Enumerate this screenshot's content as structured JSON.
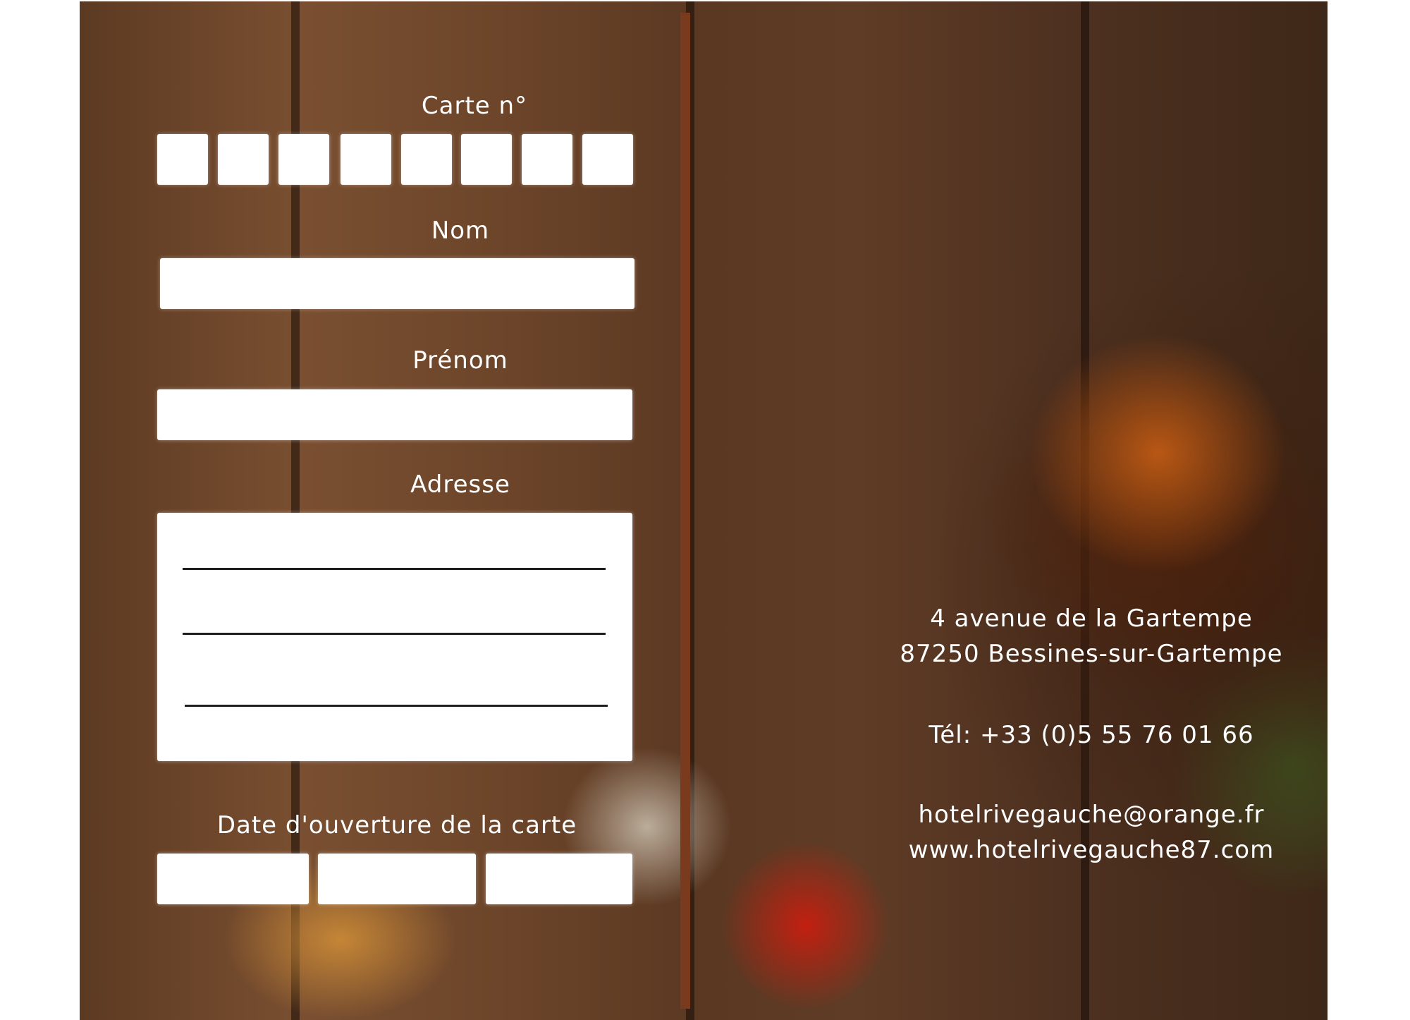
{
  "form": {
    "card_number_label": "Carte n°",
    "nom_label": "Nom",
    "prenom_label": "Prénom",
    "adresse_label": "Adresse",
    "date_label": "Date d'ouverture de la carte"
  },
  "contact": {
    "address_line1": "4 avenue de la Gartempe",
    "address_line2": "87250 Bessines-sur-Gartempe",
    "phone": "Tél: +33 (0)5 55 76 01 66",
    "email": "hotelrivegauche@orange.fr",
    "website": "www.hotelrivegauche87.com"
  }
}
